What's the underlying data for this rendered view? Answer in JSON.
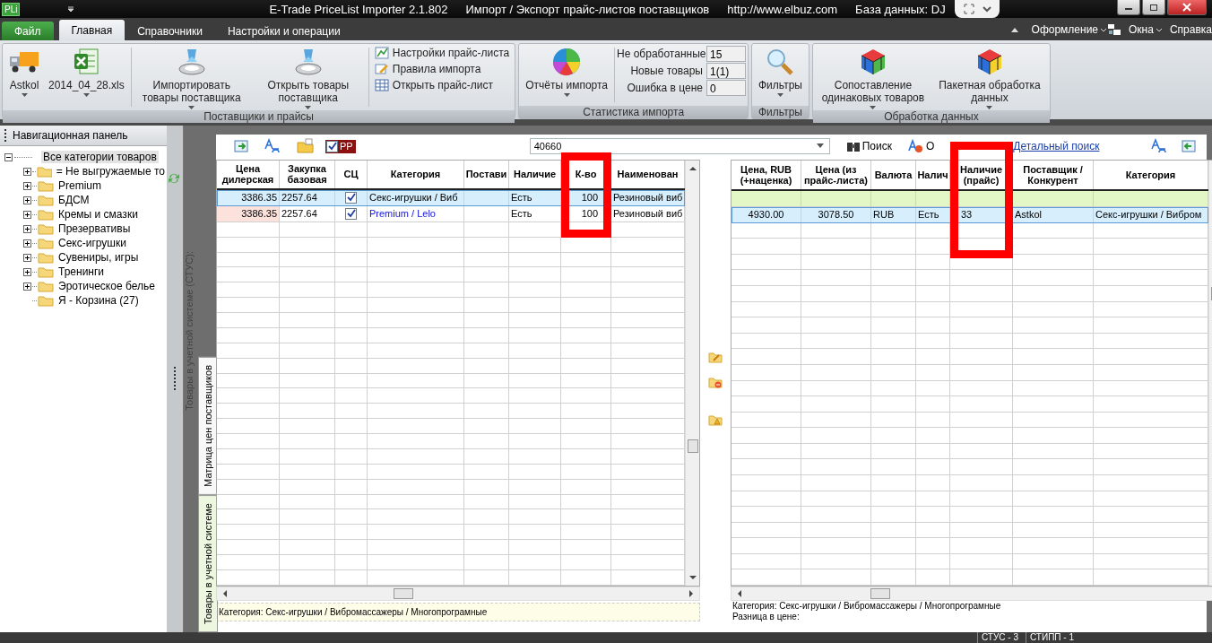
{
  "window": {
    "app_icon": "PLi",
    "title": "E-Trade PriceList Importer 2.1.802",
    "subtitle": "Импорт / Экспорт прайс-листов поставщиков",
    "url": "http://www.elbuz.com",
    "database": "База данных: DJ"
  },
  "menu_tabs": [
    {
      "label": "Файл",
      "kind": "file",
      "selected": false
    },
    {
      "label": "Главная",
      "kind": "tab",
      "selected": true
    },
    {
      "label": "Справочники",
      "kind": "tab",
      "selected": false
    },
    {
      "label": "Настройки и операции",
      "kind": "tab",
      "selected": false
    }
  ],
  "menu_right": [
    {
      "label": "Оформление",
      "kind": "dropdown"
    },
    {
      "label": "Окна",
      "kind": "icon-dropdown"
    },
    {
      "label": "Справка",
      "kind": "plain"
    }
  ],
  "ribbon": [
    {
      "label": "Поставщики и прайсы",
      "items": [
        {
          "kind": "large",
          "label": "Astkol",
          "dropdown": true
        },
        {
          "kind": "large",
          "label": "2014_04_28.xls",
          "dropdown": true
        },
        {
          "kind": "large",
          "label": "Импортировать товары поставщика",
          "dropdown": true
        },
        {
          "kind": "large",
          "label": "Открыть товары поставщика",
          "dropdown": true
        },
        {
          "kind": "list",
          "entries": [
            "Настройки прайс-листа",
            "Правила импорта",
            "Открыть прайс-лист"
          ]
        }
      ]
    },
    {
      "label": "Статистика импорта",
      "items": [
        {
          "kind": "large",
          "label": "Отчёты импорта",
          "dropdown": true
        },
        {
          "kind": "stats",
          "stats": [
            {
              "label": "Не обработанные",
              "value": "15"
            },
            {
              "label": "Новые товары",
              "value": "1(1)"
            },
            {
              "label": "Ошибка в цене",
              "value": "0"
            }
          ]
        }
      ]
    },
    {
      "label": "Фильтры",
      "items": [
        {
          "kind": "large",
          "label": "Фильтры",
          "dropdown": true
        }
      ]
    },
    {
      "label": "Обработка данных",
      "items": [
        {
          "kind": "large",
          "label": "Сопоставление одинаковых товаров",
          "dropdown": true
        },
        {
          "kind": "large",
          "label": "Пакетная обработка данных",
          "dropdown": true
        }
      ]
    }
  ],
  "nav": {
    "title": "Навигационная панель",
    "tree": {
      "label": "Все категории товаров",
      "expanded": true,
      "selected": true,
      "children": [
        {
          "label": "= Не выгружаемые то",
          "kind": "group",
          "expanded": false
        },
        {
          "label": "Premium",
          "kind": "group",
          "expanded": false
        },
        {
          "label": "БДСМ",
          "kind": "group",
          "expanded": false
        },
        {
          "label": "Кремы и смазки",
          "kind": "group",
          "expanded": false
        },
        {
          "label": "Презервативы",
          "kind": "group",
          "expanded": false
        },
        {
          "label": "Секс-игрушки",
          "kind": "group",
          "expanded": false
        },
        {
          "label": "Сувениры, игры",
          "kind": "group",
          "expanded": false
        },
        {
          "label": "Тренинги",
          "kind": "group",
          "expanded": false
        },
        {
          "label": "Эротическое белье",
          "kind": "group",
          "expanded": false
        },
        {
          "label": "Я - Корзина (27)",
          "kind": "leaf"
        }
      ]
    }
  },
  "side_caption": "Товары в учетной системе (СТУС):",
  "side_tabs": [
    {
      "label": "Матрица цен поставщиков",
      "selected": true
    },
    {
      "label": "Товары в учетной системе",
      "selected": false
    }
  ],
  "toolbar": {
    "pp": {
      "label": "PP",
      "checked": true
    },
    "search": "40660",
    "search_button": "Поиск",
    "clear_button": "О",
    "detail_link": "Детальный поиск"
  },
  "left_grid": {
    "columns": [
      {
        "label": "Цена дилерская",
        "kind": "text",
        "highlighted": false
      },
      {
        "label": "Закупка базовая",
        "kind": "text",
        "highlighted": false
      },
      {
        "label": "СЦ",
        "kind": "check",
        "highlighted": false
      },
      {
        "label": "Категория",
        "kind": "text",
        "highlighted": false
      },
      {
        "label": "Постави",
        "kind": "text",
        "highlighted": false
      },
      {
        "label": "Наличие",
        "kind": "text",
        "highlighted": false
      },
      {
        "label": "К-во",
        "kind": "text",
        "highlighted": true
      },
      {
        "label": "Наименован",
        "kind": "text",
        "highlighted": false
      }
    ],
    "rows": [
      {
        "selected": true,
        "checked": true,
        "price_alert": false,
        "category_link": false,
        "cells": [
          "3386.35",
          "2257.64",
          null,
          "Секс-игрушки / Виб",
          null,
          "Есть",
          "100",
          "Резиновый виб"
        ]
      },
      {
        "selected": false,
        "checked": true,
        "price_alert": true,
        "category_link": true,
        "cells": [
          "3386.35",
          "2257.64",
          null,
          "Premium / Lelo",
          null,
          "Есть",
          "100",
          "Резиновый виб"
        ]
      }
    ],
    "footer": "Категория: Секс-игрушки / Вибромассажеры / Многопрограмные"
  },
  "right_grid": {
    "columns": [
      {
        "label": "Цена, RUB (+наценка)",
        "highlighted": false
      },
      {
        "label": "Цена (из прайс-листа)",
        "highlighted": false
      },
      {
        "label": "Валюта",
        "highlighted": false
      },
      {
        "label": "Налич",
        "highlighted": false
      },
      {
        "label": "Наличие (прайс)",
        "highlighted": true
      },
      {
        "label": "Поставщик / Конкурент",
        "highlighted": false
      },
      {
        "label": "Категория",
        "highlighted": false
      }
    ],
    "rows": [
      {
        "kind": "filter",
        "selected": false,
        "cells": []
      },
      {
        "kind": "data",
        "selected": true,
        "cells": [
          "4930.00",
          "3078.50",
          "RUB",
          "Есть",
          "33",
          "Astkol",
          "Секс-игрушки / Вибром"
        ]
      }
    ],
    "footer": [
      "Категория: Секс-игрушки / Вибромассажеры / Многопрограмные",
      "Разница в цене:"
    ]
  },
  "status": [
    "СТУС - 3",
    "СТИПП - 1"
  ]
}
